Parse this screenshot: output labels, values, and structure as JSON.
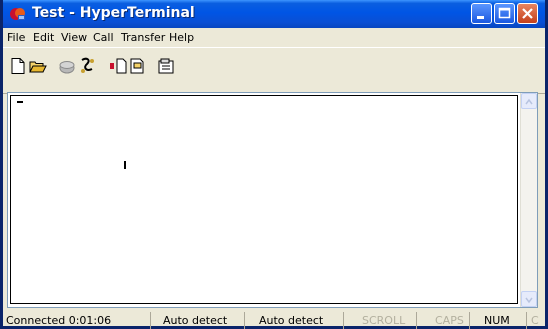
{
  "window": {
    "title": "Test - HyperTerminal",
    "title_color": "#0055e5",
    "controls": [
      "minimize-icon",
      "maximize-icon",
      "close-icon"
    ]
  },
  "menu": {
    "items": [
      "File",
      "Edit",
      "View",
      "Call",
      "Transfer",
      "Help"
    ]
  },
  "toolbar": {
    "icons": [
      "new-icon",
      "open-icon",
      "call-icon",
      "disconnect-icon",
      "send-icon",
      "receive-icon",
      "properties-icon"
    ]
  },
  "status": {
    "connection": "Connected 0:01:06",
    "emulation": "Auto detect",
    "settings": "Auto detect",
    "scroll": "SCROLL",
    "caps": "CAPS",
    "num": "NUM",
    "capture": "C"
  }
}
